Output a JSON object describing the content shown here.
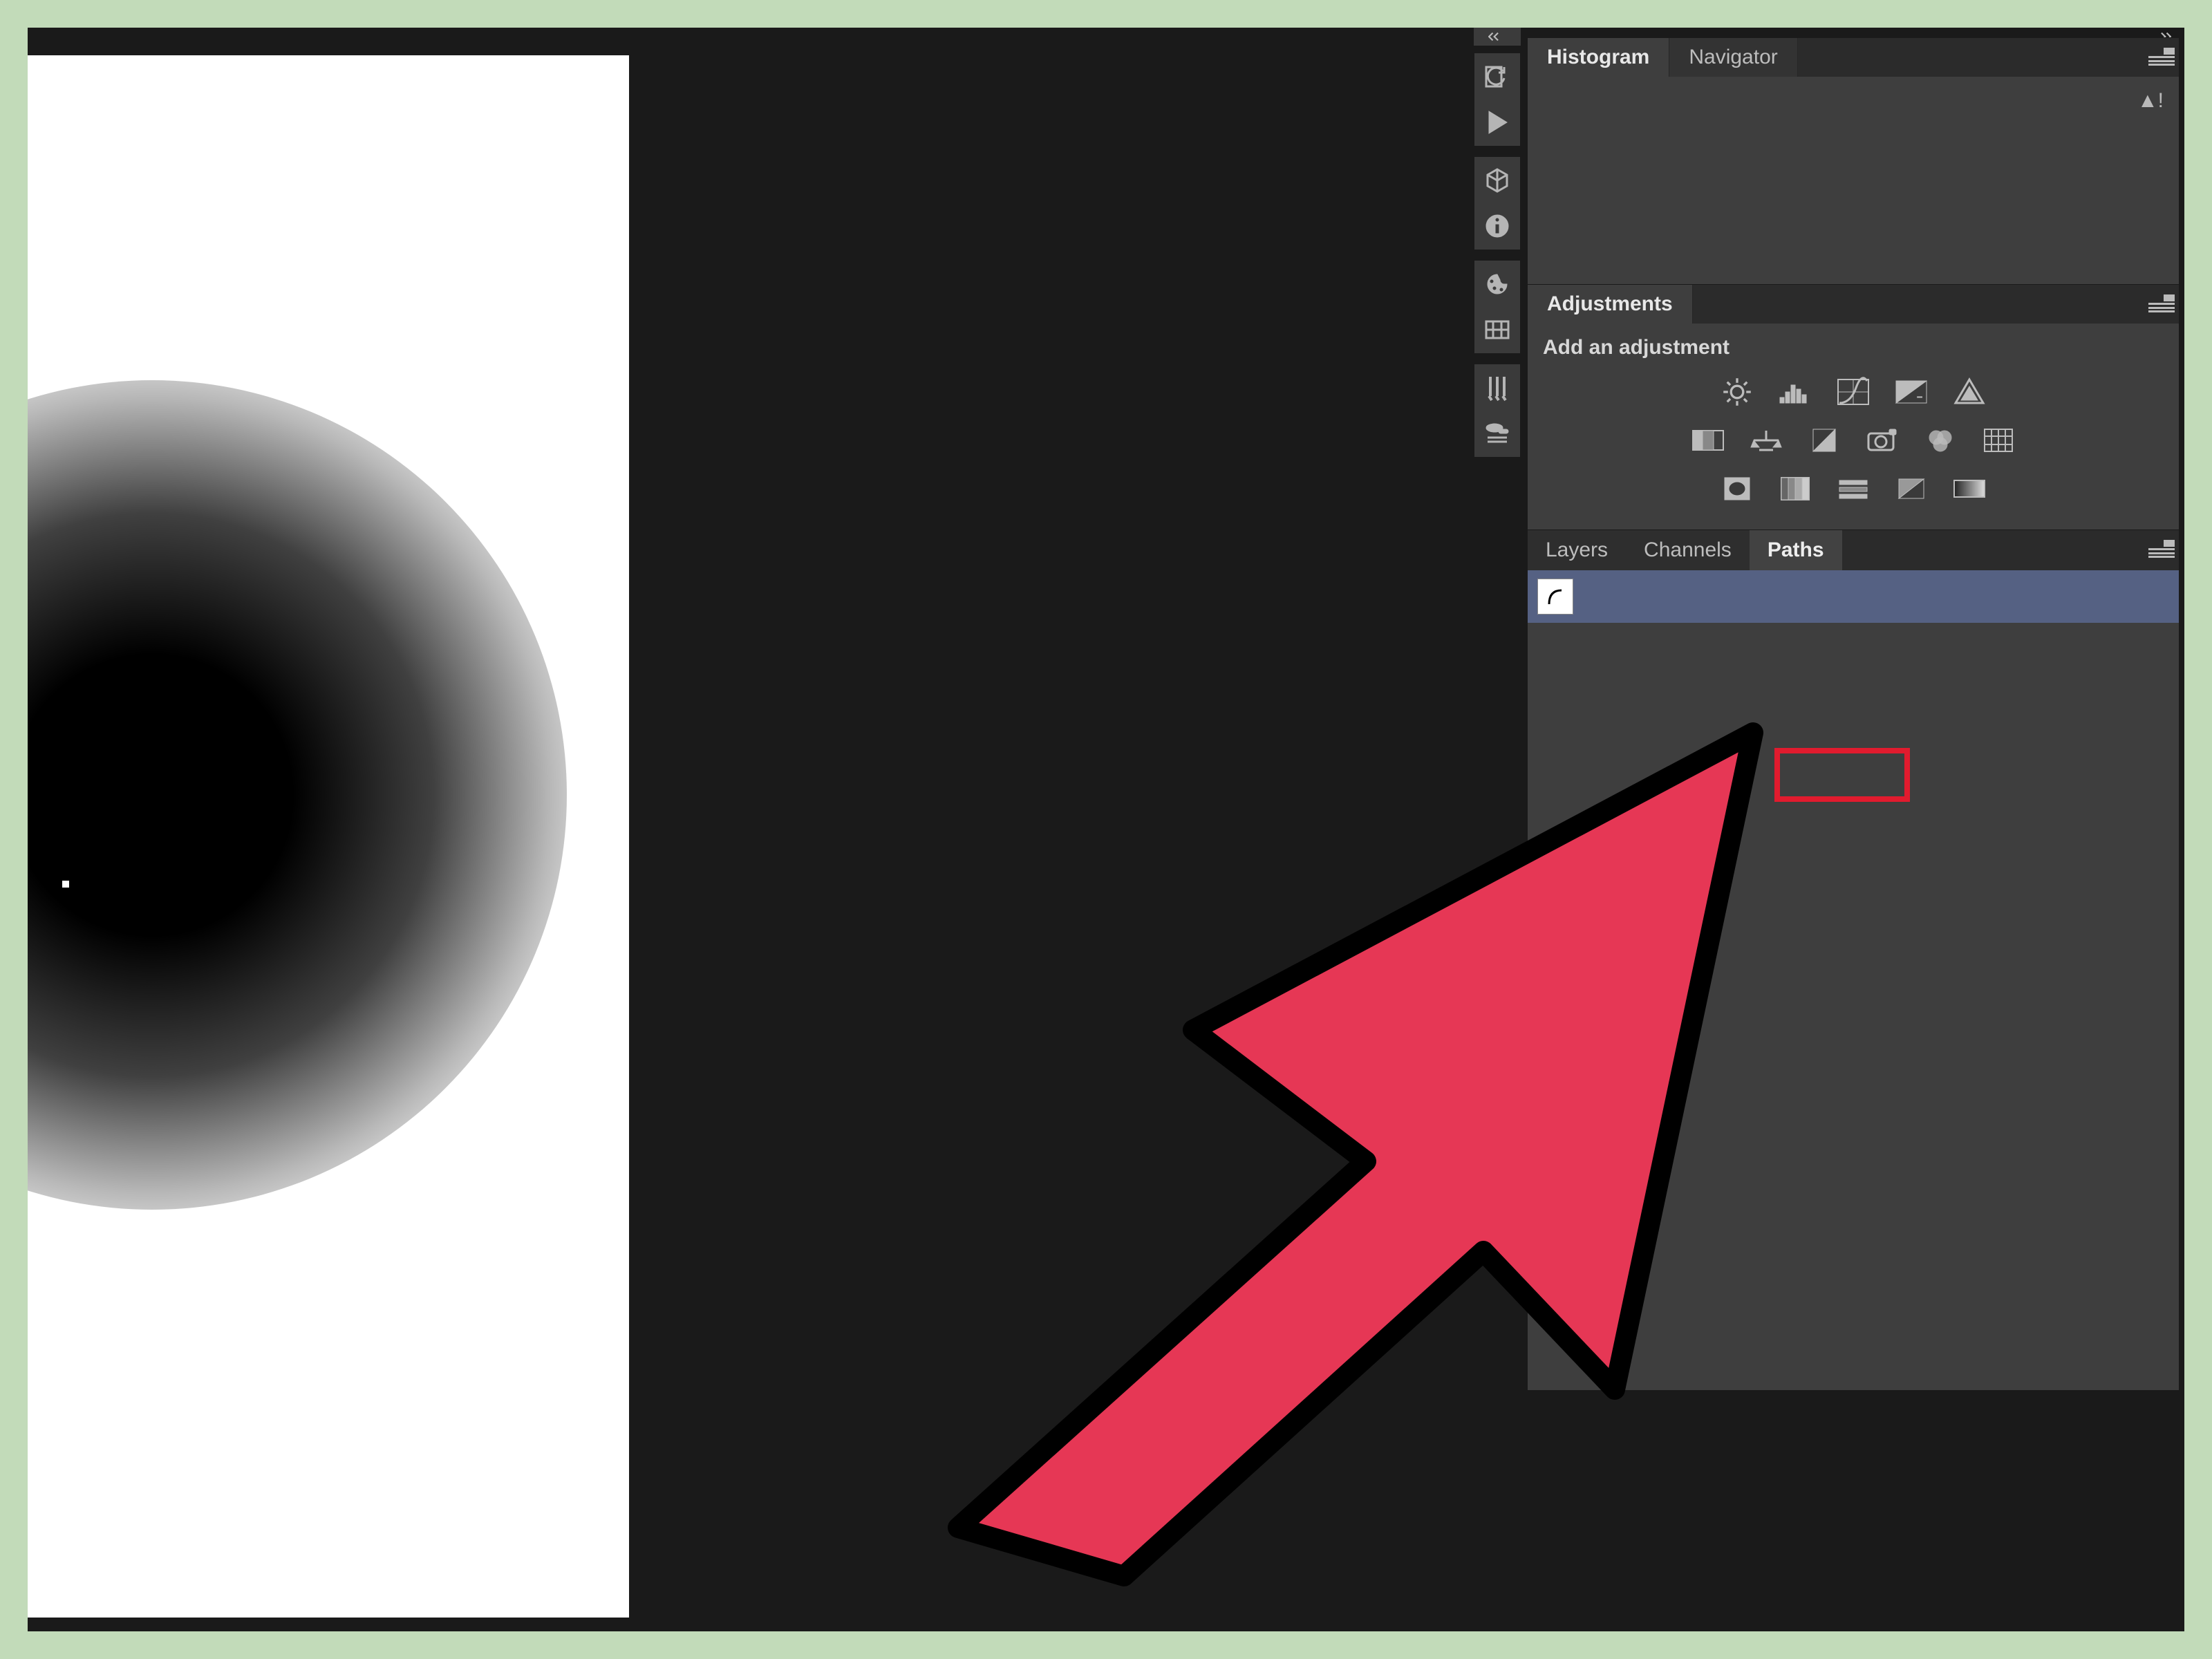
{
  "panels": {
    "histogram": {
      "tabs": [
        "Histogram",
        "Navigator"
      ],
      "active": 0
    },
    "adjustments": {
      "tab": "Adjustments",
      "title": "Add an adjustment",
      "row1": [
        "brightness",
        "levels",
        "curves",
        "exposure",
        "vibrance"
      ],
      "row2": [
        "hue",
        "balance",
        "bw",
        "photo-filter",
        "channel-mixer",
        "lookup"
      ],
      "row3": [
        "invert",
        "posterize",
        "threshold",
        "selective",
        "gradient-map"
      ]
    },
    "lcp": {
      "tabs": [
        "Layers",
        "Channels",
        "Paths"
      ],
      "active": 2
    }
  },
  "highlight_target": "Paths",
  "arrow_color": "#e63755"
}
